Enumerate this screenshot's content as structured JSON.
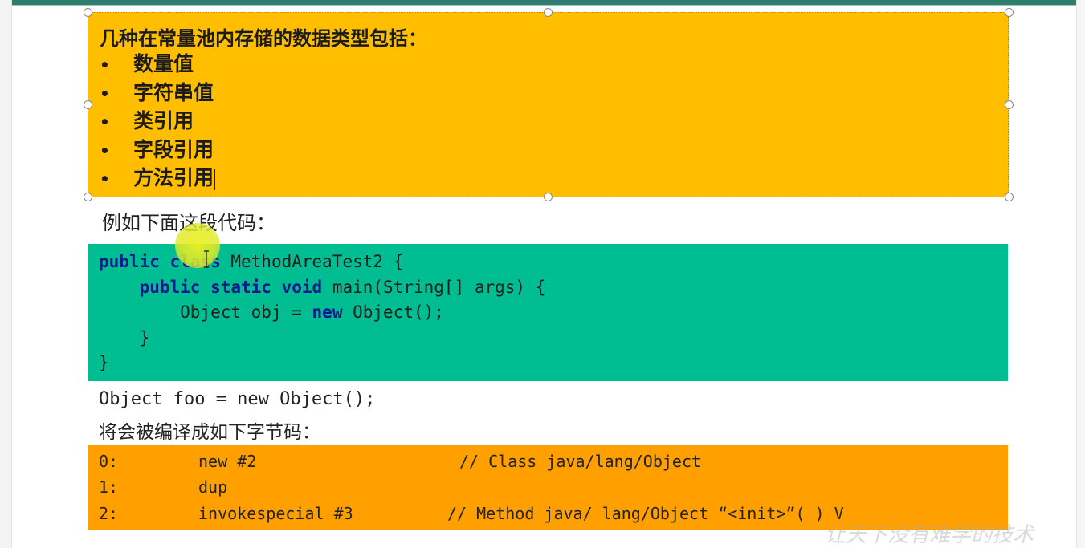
{
  "types_box": {
    "title": "几种在常量池内存储的数据类型包括：",
    "bullet": "•",
    "items": [
      "数量值",
      "字符串值",
      "类引用",
      "字段引用",
      "方法引用"
    ]
  },
  "example_label": "例如下面这段代码：",
  "code": {
    "line1": {
      "kw1": "public",
      "kw2": "class",
      "rest": " MethodAreaTest2 {"
    },
    "line2": {
      "indent": "    ",
      "kw1": "public",
      "kw2": "static",
      "kw3": "void",
      "rest": " main(String[] args) {"
    },
    "line3": {
      "indent": "        ",
      "pre": "Object obj = ",
      "kw": "new",
      "rest": " Object();"
    },
    "line4": "    }",
    "line5": "}"
  },
  "foo_line": "Object foo = new Object();",
  "compile_label": "将会被编译成如下字节码：",
  "bytecode": [
    {
      "offset": "0:",
      "instr": "new #2",
      "comment": "// Class java/lang/Object"
    },
    {
      "offset": "1:",
      "instr": "dup",
      "comment": ""
    },
    {
      "offset": "2:",
      "instr": "invokespecial #3",
      "comment": "// Method java/ lang/Object “<init>”( ) V"
    }
  ],
  "watermark": "让天下没有难学的技术",
  "colors": {
    "types_box_bg": "#ffbf00",
    "code_box_bg": "#00be92",
    "bytecode_box_bg": "#ff9f00",
    "keyword": "#101a8c",
    "top_rule": "#2e7d6e"
  }
}
